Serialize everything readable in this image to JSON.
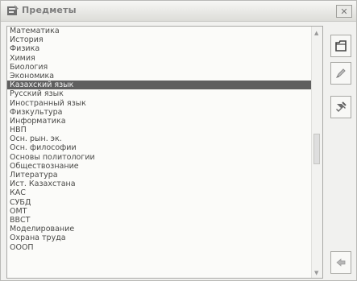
{
  "window": {
    "title": "Предметы",
    "close_label": "✕"
  },
  "subjects": [
    "Математика",
    "История",
    "Физика",
    "Химия",
    "Биология",
    "Экономика",
    "Казахский язык",
    "Русский язык",
    "Иностранный язык",
    "Физкультура",
    "Информатика",
    "НВП",
    "Осн. рын. эк.",
    "Осн. философии",
    "Основы политологии",
    "Обществознание",
    "Литература",
    "Ист. Казахстана",
    "КАС",
    "СУБД",
    "ОМТ",
    "ВВСТ",
    "Моделирование",
    "Охрана труда",
    "ОООП"
  ],
  "selected_subject": "Казахский язык",
  "selected_index": 6,
  "icons": {
    "add": "new-document-icon",
    "edit": "pencil-icon",
    "delete": "wrench-icon",
    "exit": "exit-icon"
  }
}
